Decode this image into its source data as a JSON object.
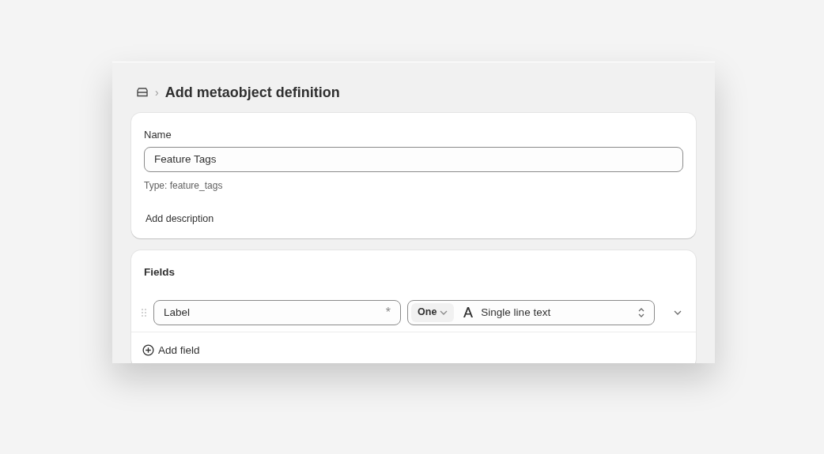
{
  "header": {
    "breadcrumb_separator": "›",
    "title": "Add metaobject definition"
  },
  "name_card": {
    "label": "Name",
    "value": "Feature Tags",
    "type_hint": "Type: feature_tags",
    "add_description": "Add description"
  },
  "fields_card": {
    "title": "Fields",
    "fields": [
      {
        "value": "Label",
        "required_mark": "*",
        "cardinality": "One",
        "type": "Single line text",
        "expanded": false
      }
    ],
    "add_field": "Add field"
  }
}
